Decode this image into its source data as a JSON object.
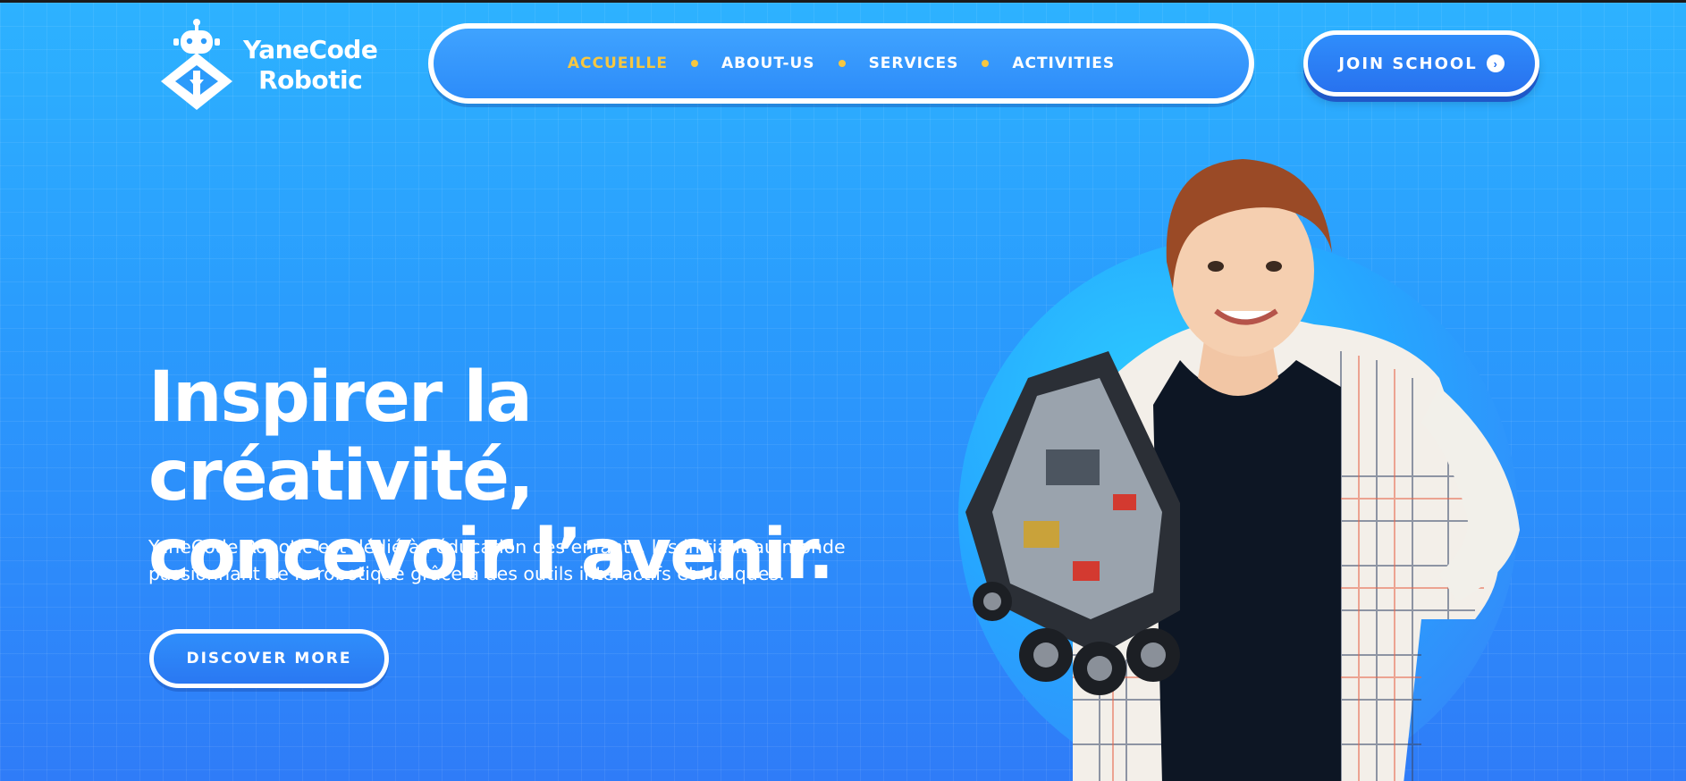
{
  "logo": {
    "line1": "YaneCode",
    "line2": "Robotic"
  },
  "nav": {
    "items": [
      {
        "label": "ACCUEILLE",
        "active": true
      },
      {
        "label": "ABOUT-US",
        "active": false
      },
      {
        "label": "SERVICES",
        "active": false
      },
      {
        "label": "ACTIVITIES",
        "active": false
      }
    ]
  },
  "header": {
    "join_label": "JOIN SCHOOL",
    "join_icon": "chevron-right-circle-icon"
  },
  "hero": {
    "title_line1": "Inspirer la créativité,",
    "title_line2": "concevoir l’avenir.",
    "description_line1": "YaneCode Robotic est dédié à l'éducation des enfants, les initiant au monde",
    "description_line2": "passionnant de la robotique grâce à des outils interactifs et ludiques.",
    "cta_label": "DISCOVER MORE"
  },
  "colors": {
    "accent": "#f7c740",
    "background_top": "#2db2ff",
    "background_bottom": "#2f7cf8",
    "button": "#2a78f2"
  }
}
